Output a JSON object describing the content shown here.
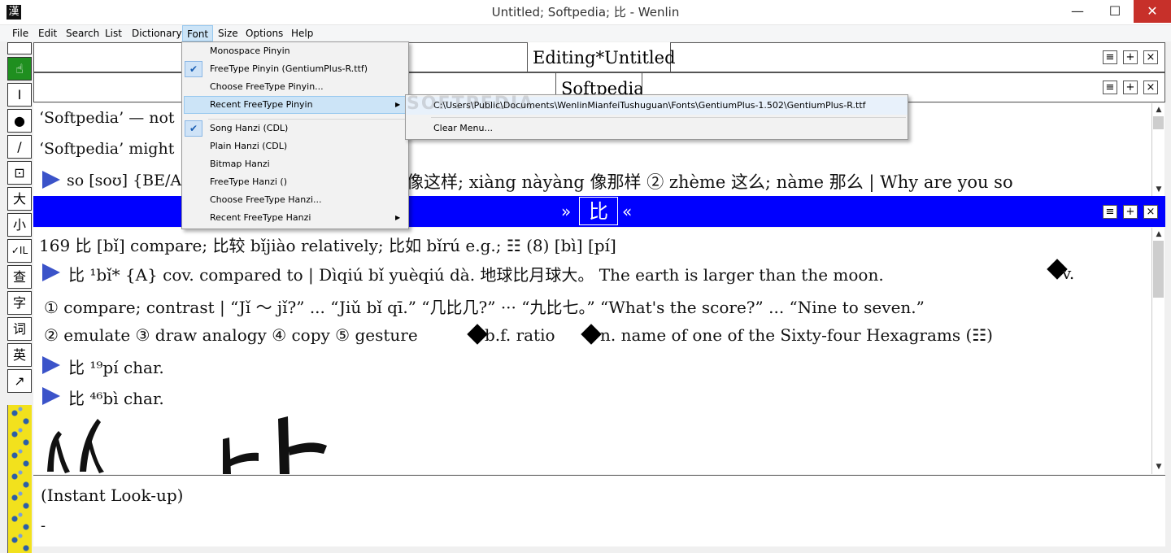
{
  "window": {
    "title": "Untitled; Softpedia; 比 - Wenlin",
    "app_icon": "漢",
    "minimize": "—",
    "maximize": "☐",
    "close": "✕"
  },
  "menubar": [
    "File",
    "Edit",
    "Search",
    "List",
    "Dictionary",
    "Font",
    "Size",
    "Options",
    "Help"
  ],
  "toolbox": {
    "hand": "☝",
    "cursor": "I",
    "dot": "●",
    "pen": "/",
    "brush": "⊡",
    "big": "大",
    "small": "小",
    "check_il": "✓IL",
    "look": "查",
    "zi": "字",
    "ci": "词",
    "ying": "英",
    "arrow": "↗"
  },
  "panes": {
    "editing_title": "Editing*Untitled",
    "softpedia_title": "Softpedia",
    "btn_menu": "≡",
    "btn_plus": "+",
    "btn_close": "×"
  },
  "edit_lines": [
    "‘Softpedia’ — not",
    "‘Softpedia’ might",
    "so [soʊ] {BE/A",
    "像这样; xiàng nàyàng 像那样 ② zhème 这么; nàme 那么 | Why are you so"
  ],
  "bluebar": {
    "hanzi": "比",
    "left_chev": "»",
    "right_chev": "«"
  },
  "dict_lines": [
    "169  比 [bǐ] compare; 比较 bǐjiào relatively; 比如 bǐrú e.g.; ☷ (8)  [bì] [pí]",
    "比  ¹bǐ* {A} cov. compared to | Dìqiú bǐ yuèqiú dà. 地球比月球大。 The earth is larger than the moon.",
    "v.",
    "① compare; contrast | “Jǐ ～ jǐ?” ... “Jiǔ bǐ qī.” “几比几?” ··· “九比七。” “What's the score?” ... “Nine to seven.”",
    "② emulate  ③ draw analogy  ④ copy  ⑤ gesture",
    "b.f. ratio",
    "n. name of one of the Sixty-four Hexagrams (☷)",
    "比  ¹⁹pí char.",
    "比  ⁴⁶bì char."
  ],
  "lookup": {
    "label": "(Instant Look-up)",
    "cursor": "-"
  },
  "font_menu": {
    "items": [
      {
        "label": "Monospace Pinyin",
        "checked": false
      },
      {
        "label": "FreeType Pinyin (GentiumPlus-R.ttf)",
        "checked": true
      },
      {
        "label": "Choose FreeType Pinyin...",
        "checked": false
      },
      {
        "label": "Recent FreeType Pinyin",
        "checked": false,
        "submenu": true
      },
      {
        "label": "Song Hanzi (CDL)",
        "checked": true
      },
      {
        "label": "Plain Hanzi (CDL)",
        "checked": false
      },
      {
        "label": "Bitmap Hanzi",
        "checked": false
      },
      {
        "label": "FreeType Hanzi ()",
        "checked": false
      },
      {
        "label": "Choose FreeType Hanzi...",
        "checked": false
      },
      {
        "label": "Recent FreeType Hanzi",
        "checked": false,
        "submenu": true
      }
    ],
    "check_glyph": "✔",
    "submenu_arrow": "▶"
  },
  "recent_submenu": {
    "path": "C:\\Users\\Public\\Documents\\WenlinMianfeiTushuguan\\Fonts\\GentiumPlus-1.502\\GentiumPlus-R.ttf",
    "clear": "Clear Menu..."
  },
  "watermark": "SOFTPEDIA",
  "colors": {
    "blue_bar": "#0000ff",
    "menu_highlight": "#cce4f7",
    "close_red": "#c7302a",
    "tool_green": "#1f8f1f",
    "strip_yellow": "#f2e11d"
  }
}
